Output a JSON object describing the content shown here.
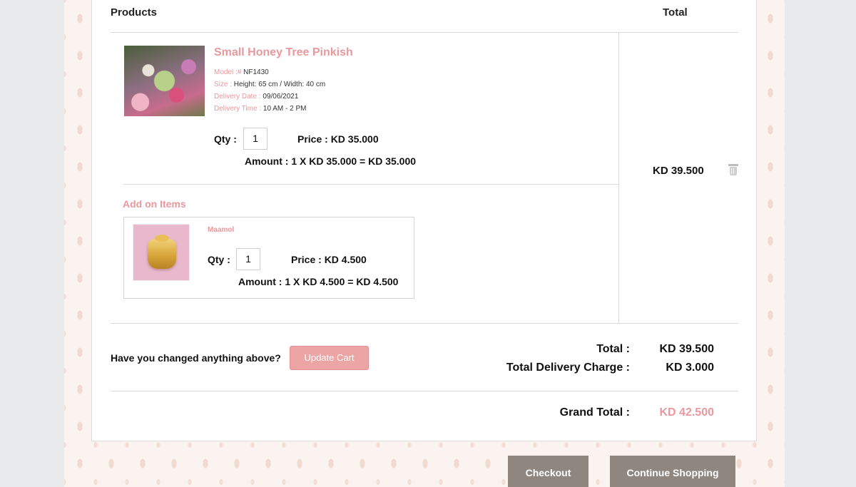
{
  "table": {
    "col_products": "Products",
    "col_total": "Total"
  },
  "product": {
    "name": "Small Honey Tree Pinkish",
    "model_label": "Model :#",
    "model_value": "NF1430",
    "size_label": "Size :",
    "size_value": "Height: 65 cm / Width: 40 cm",
    "delivery_date_label": "Delivery Date :",
    "delivery_date_value": "09/06/2021",
    "delivery_time_label": "Delivery Time :",
    "delivery_time_value": "10 AM - 2 PM",
    "qty_label": "Qty :",
    "qty_value": "1",
    "price": "Price : KD 35.000",
    "amount": "Amount : 1 X KD 35.000 = KD 35.000",
    "row_total": "KD 39.500"
  },
  "addons": {
    "heading": "Add on Items",
    "items": [
      {
        "name": "Maamol",
        "qty_label": "Qty :",
        "qty_value": "1",
        "price": "Price : KD 4.500",
        "amount": "Amount : 1 X KD 4.500 = KD 4.500"
      }
    ]
  },
  "update": {
    "question": "Have you changed anything above?",
    "button_label": "Update Cart"
  },
  "summary": {
    "total_label": "Total :",
    "total_value": "KD 39.500",
    "delivery_label": "Total Delivery Charge :",
    "delivery_value": "KD 3.000",
    "grand_label": "Grand Total :",
    "grand_value": "KD 42.500"
  },
  "actions": {
    "checkout": "Checkout",
    "continue": "Continue Shopping"
  },
  "colors": {
    "accent_pink": "#e9989e",
    "button_dark": "#8f8680",
    "button_pink": "#eca4a4"
  },
  "icons": {
    "remove": "trash-icon"
  }
}
